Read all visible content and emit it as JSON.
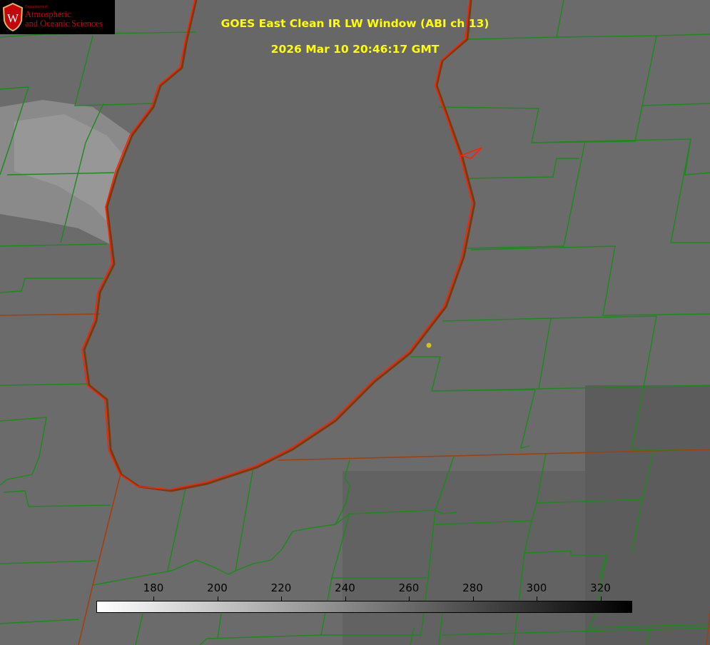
{
  "title": {
    "line1": "GOES East Clean IR LW Window (ABI ch 13)",
    "line2": "2026 Mar 10 20:46:17 GMT"
  },
  "logo": {
    "department": "Department of",
    "line1": "Atmospheric",
    "line2": "and Oceanic Sciences",
    "crest_letter": "W"
  },
  "colorbar": {
    "ticks": [
      "180",
      "200",
      "220",
      "240",
      "260",
      "280",
      "300",
      "320"
    ],
    "min_color": "#ffffff",
    "max_color": "#000000"
  },
  "colors": {
    "background": "#6a6a6a",
    "lake": "#676767",
    "cloud": "#909090",
    "county_lines": "#1a8a1a",
    "state_lines": "#a04010",
    "coastline": "#ff2000",
    "marker": "#d4c020",
    "title_text": "#ffff00"
  }
}
